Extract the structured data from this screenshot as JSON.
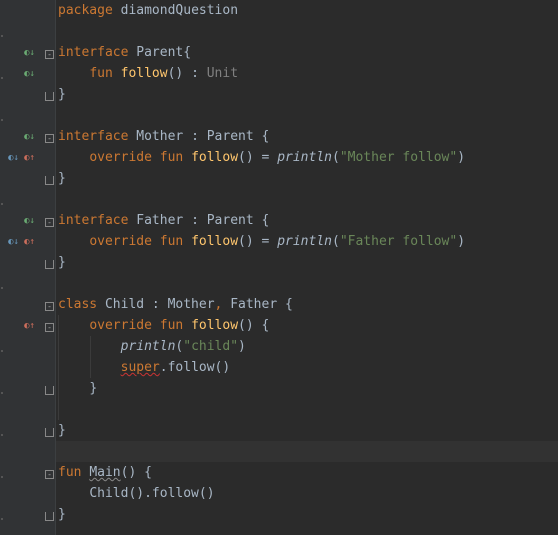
{
  "editor": {
    "colors": {
      "background": "#2b2b2b",
      "gutter": "#313335",
      "keyword": "#cc7832",
      "function": "#ffc66d",
      "string": "#6a8759",
      "text": "#a9b7c6",
      "comment": "#808080"
    },
    "gutter_icons": {
      "implemented": "implemented-by-icon",
      "overrides": "overrides-icon",
      "fold": "fold-icon"
    },
    "lines": {
      "l1": {
        "kw": "package",
        "rest": " diamondQuestion"
      },
      "l3": {
        "kw": "interface",
        "rest": " Parent{"
      },
      "l4": {
        "kw": "fun",
        "fn": "follow",
        "mid": "() : ",
        "ret": "Unit"
      },
      "l5": {
        "rest": "}"
      },
      "l7": {
        "kw": "interface",
        "rest": " Mother : Parent {"
      },
      "l8": {
        "kw1": "override",
        "kw2": "fun",
        "fn": "follow",
        "mid": "() = ",
        "call": "println",
        "open": "(",
        "str": "\"Mother follow\"",
        "close": ")"
      },
      "l9": {
        "rest": "}"
      },
      "l11": {
        "kw": "interface",
        "rest": " Father : Parent {"
      },
      "l12": {
        "kw1": "override",
        "kw2": "fun",
        "fn": "follow",
        "mid": "() = ",
        "call": "println",
        "open": "(",
        "str": "\"Father follow\"",
        "close": ")"
      },
      "l13": {
        "rest": "}"
      },
      "l15": {
        "kw": "class",
        "rest1": " Child : Mother",
        "comma": ",",
        "rest2": " Father {"
      },
      "l16": {
        "kw1": "override",
        "kw2": "fun",
        "fn": "follow",
        "mid": "() {"
      },
      "l17": {
        "call": "println",
        "open": "(",
        "str": "\"child\"",
        "close": ")"
      },
      "l18": {
        "sup": "super",
        "rest": ".follow()"
      },
      "l19": {
        "rest": "}"
      },
      "l21": {
        "rest": "}"
      },
      "l23": {
        "kw": "fun",
        "fn": "Main",
        "rest": "() {"
      },
      "l24": {
        "rest": "Child().follow()"
      },
      "l25": {
        "rest": "}"
      }
    }
  }
}
